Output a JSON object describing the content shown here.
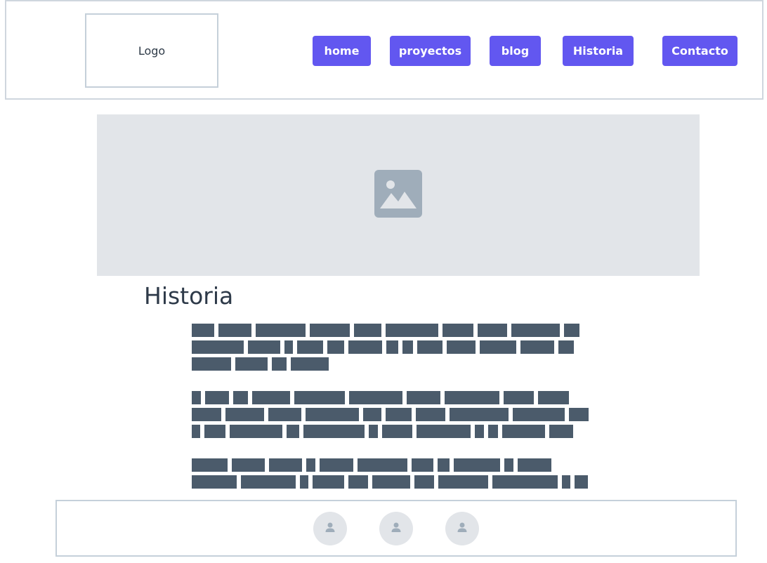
{
  "header": {
    "logo_text": "Logo",
    "nav": [
      {
        "label": "home"
      },
      {
        "label": "proyectos"
      },
      {
        "label": "blog"
      },
      {
        "label": "Historia"
      },
      {
        "label": "Contacto"
      }
    ]
  },
  "hero": {
    "icon": "image-placeholder-icon"
  },
  "main": {
    "title": "Historia"
  },
  "footer": {
    "social_icons": [
      "user-icon",
      "user-icon",
      "user-icon"
    ]
  },
  "colors": {
    "accent": "#6257f0",
    "placeholder_bg": "#e2e5e9",
    "text_block": "#4b5b6b",
    "border": "#c5d0da"
  }
}
